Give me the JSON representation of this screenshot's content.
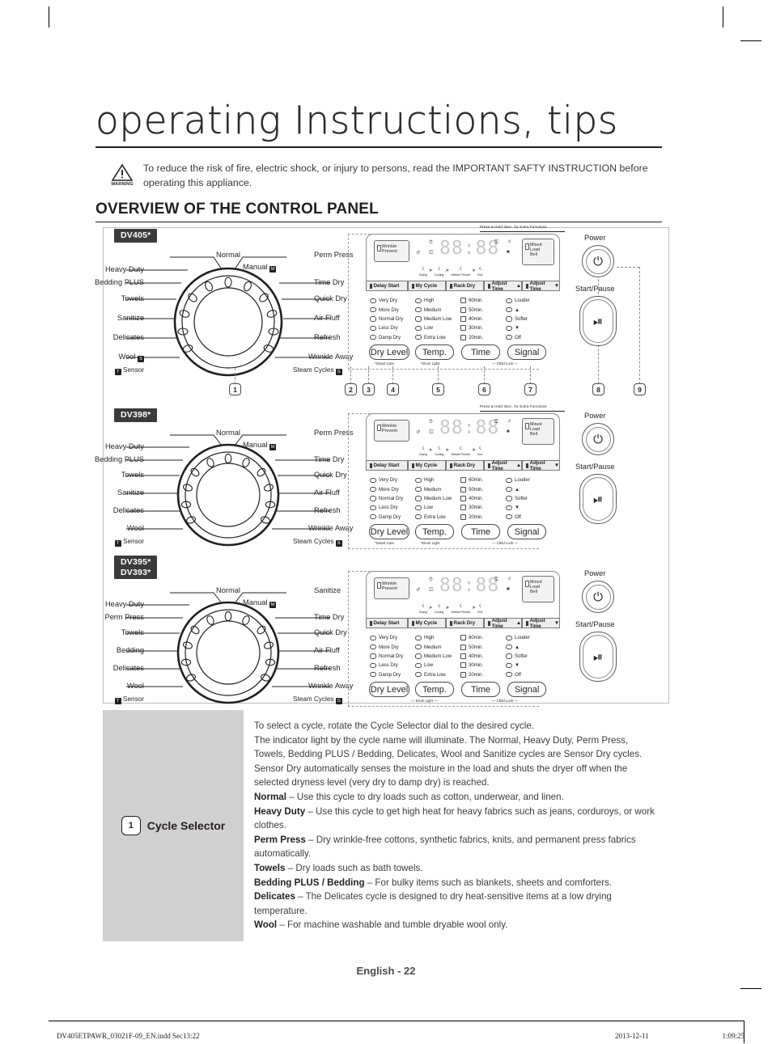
{
  "page": {
    "title": "operating Instructions, tips",
    "section_heading": "OVERVIEW OF THE CONTROL PANEL",
    "page_number": "English - 22"
  },
  "warning": {
    "icon_label": "WARNING",
    "text": "To reduce the risk of fire, electric shock, or injury to persons, read the IMPORTANT SAFTY INSTRUCTION before operating this appliance."
  },
  "panels": [
    {
      "model": "DV405*",
      "model_line2": "",
      "dial": {
        "left": [
          "Heavy Duty",
          "Bedding PLUS",
          "Towels",
          "Sanitize",
          "Delicates",
          "Wool"
        ],
        "right": [
          "Perm Press",
          "Time Dry",
          "Quick Dry",
          "Air Fluff",
          "Refresh",
          "Wrinkle Away"
        ],
        "top": "Normal",
        "manual": "Manual",
        "sensor": "Sensor",
        "steam_cycles": "Steam Cycles",
        "wool_has_steam_icon": true
      },
      "callout": "1"
    },
    {
      "model": "DV398*",
      "model_line2": "",
      "dial": {
        "left": [
          "Heavy Duty",
          "Bedding PLUS",
          "Towels",
          "Sanitize",
          "Delicates",
          "Wool"
        ],
        "right": [
          "Perm Press",
          "Time Dry",
          "Quick Dry",
          "Air Fluff",
          "Refresh",
          "Wrinkle Away"
        ],
        "top": "Normal",
        "manual": "Manual",
        "sensor": "Sensor",
        "steam_cycles": "Steam Cycles",
        "wool_has_steam_icon": false
      },
      "callout": ""
    },
    {
      "model": "DV395*",
      "model_line2": "DV393*",
      "dial": {
        "left": [
          "Heavy Duty",
          "Perm Press",
          "Towels",
          "Bedding",
          "Delicates",
          "Wool"
        ],
        "right": [
          "Sanitize",
          "Time Dry",
          "Quick Dry",
          "Air Fluff",
          "Refresh",
          "Wrinkle Away"
        ],
        "top": "Normal",
        "manual": "Manual",
        "sensor": "Sensor",
        "steam_cycles": "Steam Cycles",
        "wool_has_steam_icon": false
      },
      "callout": ""
    }
  ],
  "console": {
    "note": "Press & Hold 3sec. for Extra Functions",
    "wrinkle_prevent": "Wrinkle\nPrevent",
    "wrinkle_prevent_l1": "Wrinkle",
    "wrinkle_prevent_l2": "Prevent",
    "mixed_load_bell_l1": "Mixed",
    "mixed_load_bell_l2": "Load",
    "mixed_load_bell_l3": "Bell",
    "display_segments": "88:88",
    "progress": [
      "Drying",
      "Cooling",
      "Wrinkle Prevent",
      "End"
    ],
    "top_buttons": [
      "Delay Start",
      "My Cycle",
      "Rack Dry",
      "Adjust Time",
      "Adjust Time"
    ],
    "adjust_up": "▲",
    "adjust_down": "▼",
    "option_columns": [
      {
        "items": [
          "Very Dry",
          "More Dry",
          "Normal Dry",
          "Less Dry",
          "Damp Dry"
        ],
        "shape": "dot"
      },
      {
        "items": [
          "High",
          "Medium",
          "Medium Low",
          "Low",
          "Extra Low"
        ],
        "shape": "dot"
      },
      {
        "items": [
          "60min.",
          "50min.",
          "40min.",
          "30min.",
          "20min."
        ],
        "shape": "square"
      },
      {
        "items": [
          "Louder",
          "▲",
          "Softer",
          "▼",
          "Off"
        ],
        "shape": "dot"
      }
    ],
    "round_buttons": [
      "Dry Level",
      "Temp.",
      "Time",
      "Signal"
    ],
    "sub_labels": [
      "Smart Care",
      "Drum Light"
    ],
    "child_lock": "Child Lock",
    "power_label": "Power",
    "start_pause_label": "Start/Pause",
    "callouts": [
      "2",
      "3",
      "4",
      "5",
      "6",
      "7",
      "8",
      "9"
    ]
  },
  "description": {
    "callout": "1",
    "title": "Cycle Selector",
    "paragraphs": [
      {
        "bold": "",
        "text": "To select a cycle, rotate the Cycle Selector dial to the desired cycle."
      },
      {
        "bold": "",
        "text": "The indicator light by the cycle name will illuminate. The Normal, Heavy Duty, Perm Press, Towels, Bedding PLUS / Bedding, Delicates, Wool and Sanitize cycles are Sensor Dry cycles."
      },
      {
        "bold": "",
        "text": "Sensor Dry automatically senses the moisture in the load and shuts the dryer off when the selected dryness level (very dry to damp dry) is reached."
      },
      {
        "bold": "Normal",
        "text": " – Use this cycle to dry loads such as cotton, underwear, and linen."
      },
      {
        "bold": "Heavy Duty",
        "text": " – Use this cycle to get high heat for heavy fabrics such as jeans, corduroys, or work clothes."
      },
      {
        "bold": "Perm Press",
        "text": " – Dry wrinkle-free cottons, synthetic fabrics, knits, and permanent press fabrics automatically."
      },
      {
        "bold": "Towels",
        "text": " – Dry loads such as bath towels."
      },
      {
        "bold": "Bedding PLUS / Bedding",
        "text": " – For bulky items such as blankets, sheets and comforters."
      },
      {
        "bold": "Delicates",
        "text": " – The Delicates cycle is designed to dry heat-sensitive items at a low drying temperature."
      },
      {
        "bold": "Wool",
        "text": " – For machine washable and tumble dryable wool only."
      }
    ]
  },
  "footer": {
    "file": "DV405ETPAWR_03021F-09_EN.indd   Sec13:22",
    "date": "2013-12-11",
    "time": "1:09:25"
  }
}
